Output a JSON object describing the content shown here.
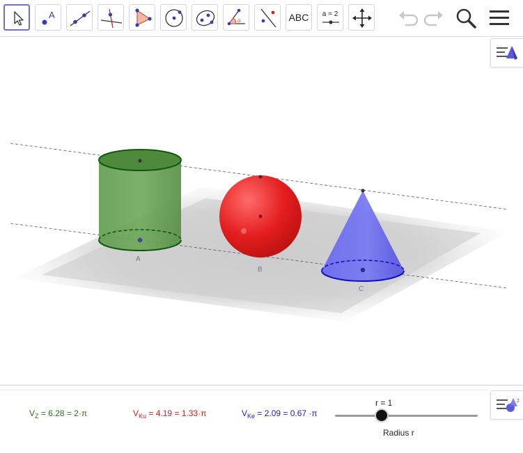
{
  "toolbar": {
    "tools": [
      {
        "name": "move-tool",
        "icon": "arrow-pointer-icon"
      },
      {
        "name": "point-tool",
        "icon": "point-a-icon"
      },
      {
        "name": "line-tool",
        "icon": "line-through-points-icon"
      },
      {
        "name": "perpendicular-line-tool",
        "icon": "perpendicular-line-icon"
      },
      {
        "name": "polygon-tool",
        "icon": "triangle-icon"
      },
      {
        "name": "circle-tool",
        "icon": "circle-center-icon"
      },
      {
        "name": "conic-tool",
        "icon": "ellipse-icon"
      },
      {
        "name": "angle-tool",
        "icon": "angle-icon"
      },
      {
        "name": "reflect-tool",
        "icon": "reflect-line-icon"
      },
      {
        "name": "text-tool",
        "icon": "text-abc-icon",
        "label": "ABC"
      },
      {
        "name": "slider-tool",
        "icon": "slider-icon",
        "label": "a = 2"
      },
      {
        "name": "move-view-tool",
        "icon": "move-arrows-icon"
      }
    ],
    "active_tool": "move-tool"
  },
  "graphics": {
    "point_labels": {
      "cylinder": "A",
      "sphere": "B",
      "cone": "C"
    }
  },
  "algebra": {
    "volume_cylinder": {
      "symbol": "V",
      "sub": "Z",
      "text": " = 6.28 =  2·π",
      "color": "#2e6b1f"
    },
    "volume_sphere": {
      "symbol": "V",
      "sub": "Ku",
      "text": " =  4.19 = 1.33·π",
      "color": "#d21c1c"
    },
    "volume_cone": {
      "symbol": "V",
      "sub": "Ke",
      "text": " = 2.09 = 0.67 ·π",
      "color": "#1a1ad6"
    },
    "slider": {
      "value_label": "r = 1",
      "caption": "Radius r",
      "value": 1
    }
  },
  "colors": {
    "cylinder": "#4f8a3c",
    "sphere": "#e01e1e",
    "cone": "#5252e6",
    "tool_active_border": "#6b72c4"
  }
}
